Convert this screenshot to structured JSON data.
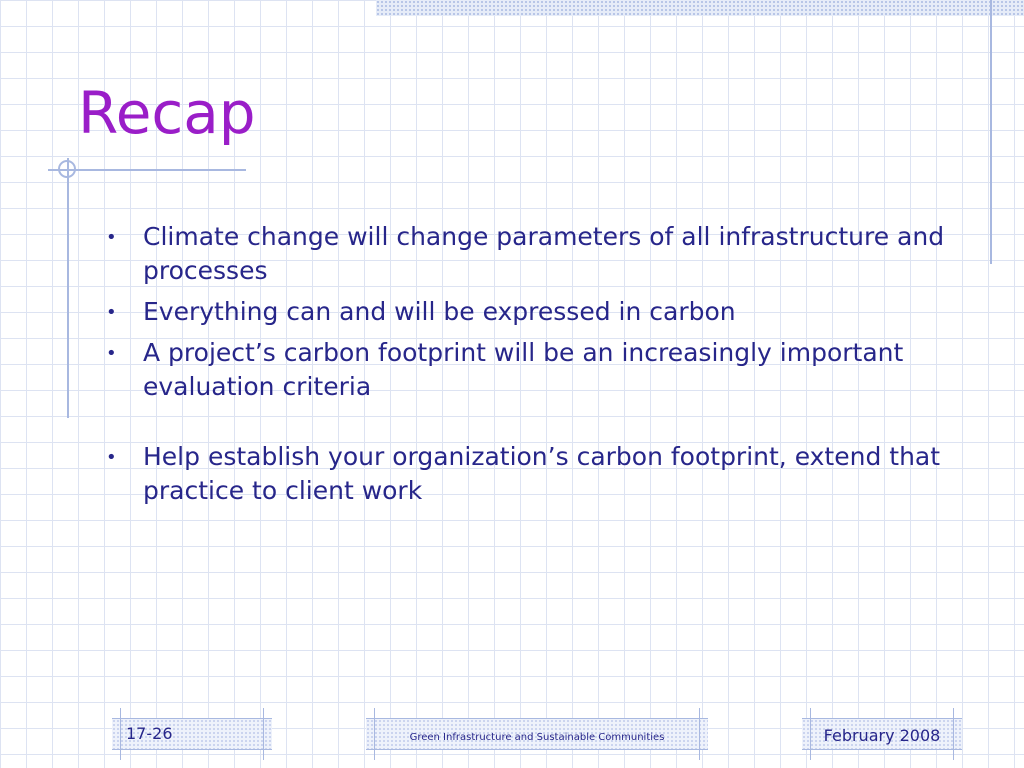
{
  "slide": {
    "title": "Recap",
    "bullets": [
      "Climate change will change parameters of all infrastructure and processes",
      "Everything can and will be expressed in carbon",
      "A project’s carbon footprint will be an increasingly important evaluation criteria",
      "Help establish your organization’s carbon footprint, extend that practice to client work"
    ]
  },
  "footer": {
    "slide_number": "17-26",
    "center_text": "Green Infrastructure and Sustainable Communities",
    "date": "February 2008"
  },
  "colors": {
    "title": "#9a1ec8",
    "text": "#27268a",
    "grid": "#dde3f2",
    "accent_lines": "#a8b8e0"
  },
  "icons": {
    "bullet": "bullet-dot"
  }
}
